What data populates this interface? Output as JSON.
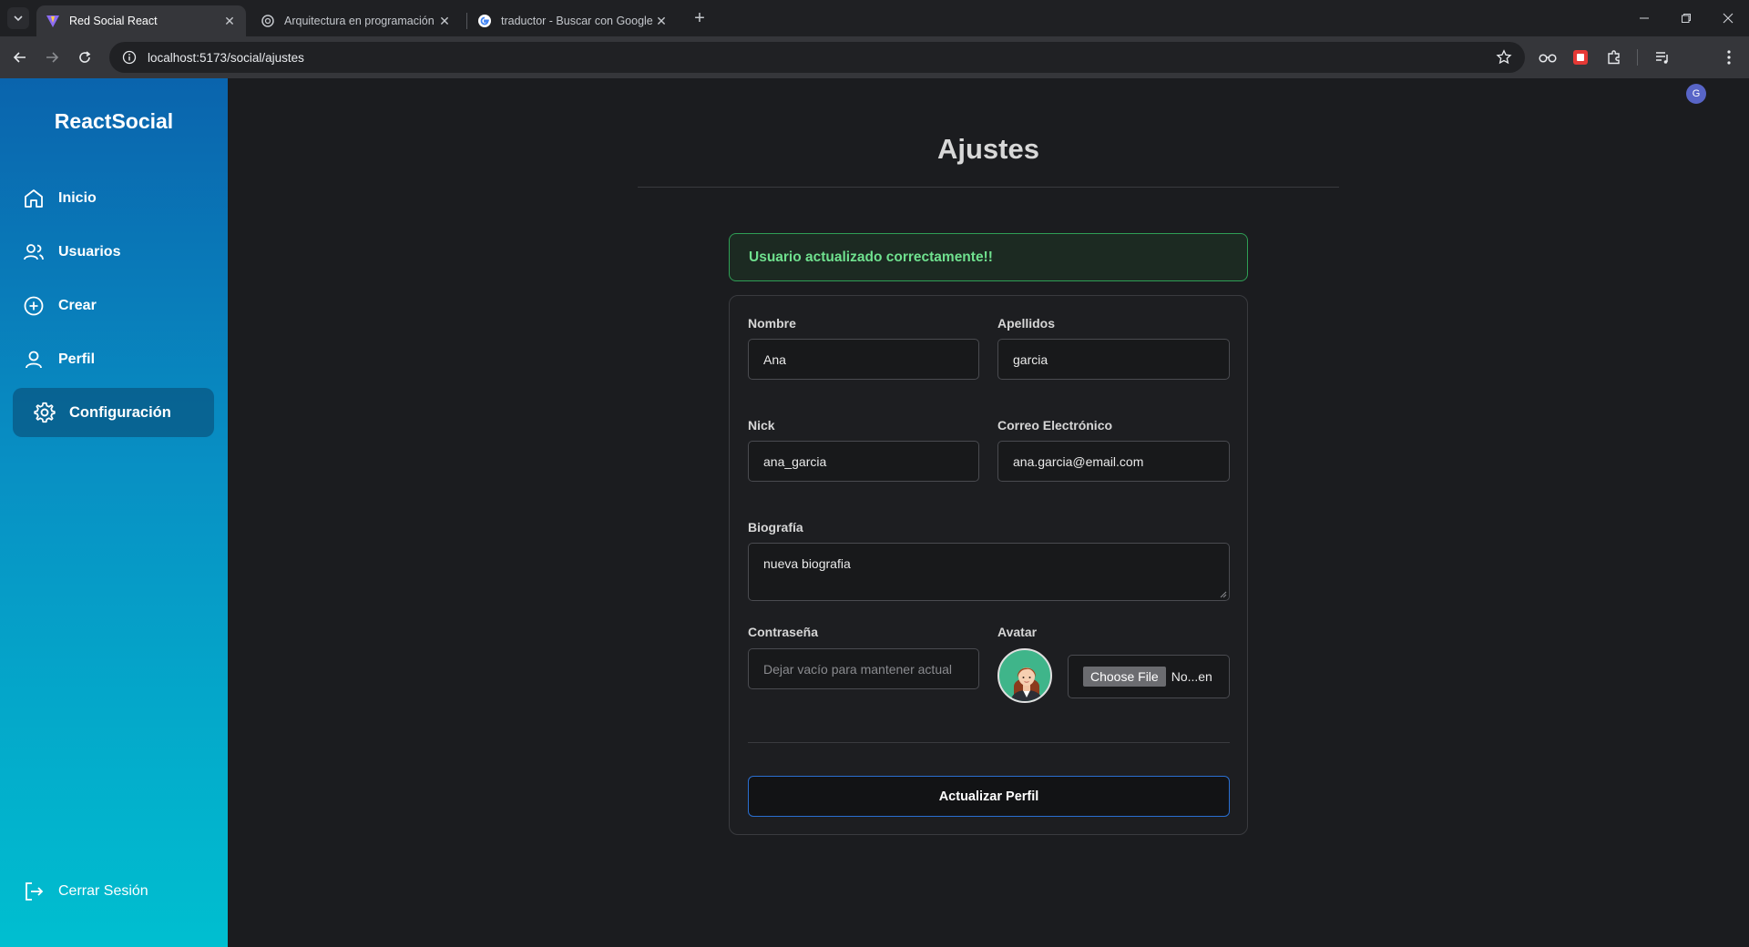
{
  "browser": {
    "tabs": [
      {
        "title": "Red Social React",
        "icon": "vite-icon"
      },
      {
        "title": "Arquitectura en programación",
        "icon": "openai-icon"
      },
      {
        "title": "traductor - Buscar con Google",
        "icon": "google-icon"
      }
    ],
    "url": "localhost:5173/social/ajustes",
    "profile_initial": "G"
  },
  "sidebar": {
    "brand": "ReactSocial",
    "items": [
      {
        "label": "Inicio",
        "icon": "home-icon"
      },
      {
        "label": "Usuarios",
        "icon": "users-icon"
      },
      {
        "label": "Crear",
        "icon": "plus-circle-icon"
      },
      {
        "label": "Perfil",
        "icon": "user-icon"
      },
      {
        "label": "Configuración",
        "icon": "gear-icon",
        "active": true
      }
    ],
    "logout": "Cerrar Sesión"
  },
  "main": {
    "title": "Ajustes",
    "alert": "Usuario actualizado correctamente!!",
    "form": {
      "nombre_label": "Nombre",
      "nombre_value": "Ana",
      "apellidos_label": "Apellidos",
      "apellidos_value": "garcia",
      "nick_label": "Nick",
      "nick_value": "ana_garcia",
      "email_label": "Correo Electrónico",
      "email_value": "ana.garcia@email.com",
      "bio_label": "Biografía",
      "bio_value": "nueva biografia",
      "password_label": "Contraseña",
      "password_placeholder": "Dejar vacío para mantener actual",
      "avatar_label": "Avatar",
      "file_button": "Choose File",
      "file_name": "No...en",
      "submit": "Actualizar Perfil"
    }
  },
  "colors": {
    "sidebar_top": "#0a64ad",
    "sidebar_bottom": "#00bfd0",
    "alert_green": "#6fe08e",
    "submit_border": "#2a6fd1"
  }
}
